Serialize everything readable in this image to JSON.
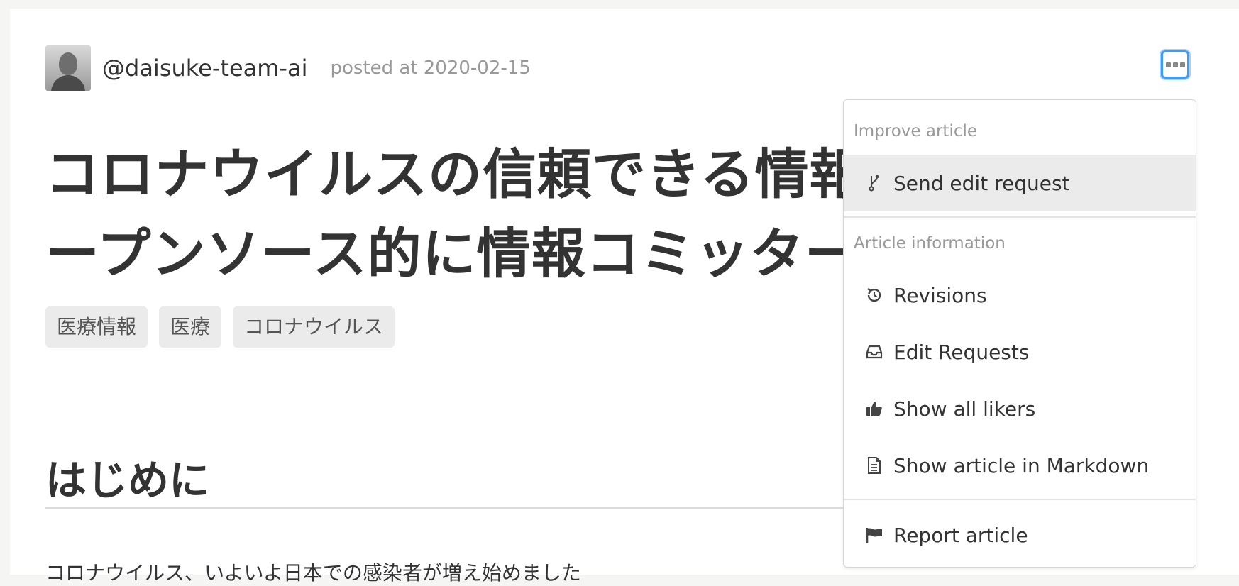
{
  "author": {
    "username": "@daisuke-team-ai",
    "posted": "posted at 2020-02-15"
  },
  "article": {
    "title_line1": "コロナウイルスの信頼できる情報",
    "title_line2": "ープンソース的に情報コミッター",
    "tags": [
      "医療情報",
      "医療",
      "コロナウイルス"
    ],
    "section_heading": "はじめに",
    "body_first_line": "コロナウイルス、いよいよ日本での感染者が増え始めました"
  },
  "menu": {
    "improve_header": "Improve article",
    "send_edit_request": "Send edit request",
    "info_header": "Article information",
    "revisions": "Revisions",
    "edit_requests": "Edit Requests",
    "show_all_likers": "Show all likers",
    "show_markdown": "Show article in Markdown",
    "report_article": "Report article"
  },
  "colors": {
    "focus_ring": "#3e9bf7",
    "active_item_bg": "#ebebeb",
    "tag_bg": "#ebebeb"
  },
  "icons": {
    "more": "more-dots-icon",
    "send_edit_request": "branch-icon",
    "revisions": "history-icon",
    "edit_requests": "inbox-icon",
    "show_all_likers": "thumbs-up-icon",
    "show_markdown": "document-icon",
    "report_article": "flag-icon"
  }
}
